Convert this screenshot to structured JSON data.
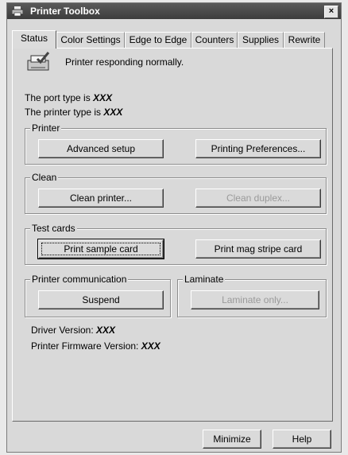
{
  "window": {
    "title": "Printer Toolbox",
    "close_glyph": "×"
  },
  "tabs": [
    {
      "label": "Status"
    },
    {
      "label": "Color Settings"
    },
    {
      "label": "Edge to Edge"
    },
    {
      "label": "Counters"
    },
    {
      "label": "Supplies"
    },
    {
      "label": "Rewrite"
    }
  ],
  "status": {
    "message": "Printer responding normally.",
    "port_prefix": "The port type is",
    "port_value": "XXX",
    "printer_prefix": "The printer type is",
    "printer_value": "XXX"
  },
  "groups": {
    "printer": {
      "title": "Printer",
      "advanced": "Advanced setup",
      "preferences": "Printing Preferences..."
    },
    "clean": {
      "title": "Clean",
      "clean_printer": "Clean printer...",
      "clean_duplex": "Clean duplex..."
    },
    "test_cards": {
      "title": "Test cards",
      "sample": "Print sample card",
      "mag": "Print mag stripe card"
    },
    "communication": {
      "title": "Printer communication",
      "suspend": "Suspend"
    },
    "laminate": {
      "title": "Laminate",
      "laminate_only": "Laminate only..."
    }
  },
  "versions": {
    "driver_prefix": "Driver Version:",
    "driver_value": "XXX",
    "firmware_prefix": "Printer Firmware Version:",
    "firmware_value": "XXX"
  },
  "footer": {
    "minimize": "Minimize",
    "help": "Help"
  }
}
